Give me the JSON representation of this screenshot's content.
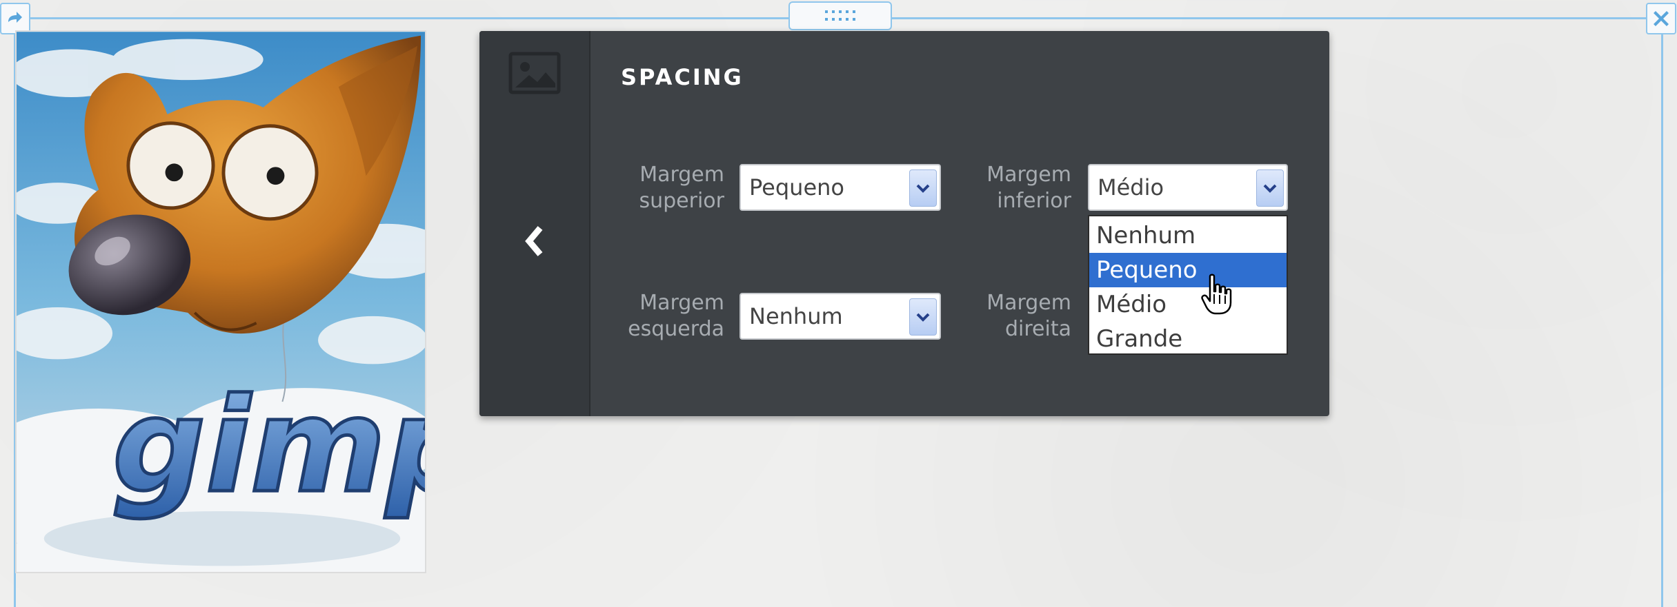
{
  "panel": {
    "title": "SPACING"
  },
  "fields": {
    "top_margin": {
      "label_line1": "Margem",
      "label_line2": "superior",
      "value": "Pequeno"
    },
    "bottom_margin": {
      "label_line1": "Margem",
      "label_line2": "inferior",
      "value": "Médio",
      "expanded": true,
      "options": [
        "Nenhum",
        "Pequeno",
        "Médio",
        "Grande"
      ],
      "highlighted_option": "Pequeno"
    },
    "left_margin": {
      "label_line1": "Margem",
      "label_line2": "esquerda",
      "value": "Nenhum"
    },
    "right_margin": {
      "label_line1": "Margem",
      "label_line2": "direita"
    }
  },
  "image": {
    "logo_text": "gimp"
  },
  "icons": {
    "top_left_handle": "arrow-icon",
    "top_right_handle": "close-icon",
    "top_center_handle": "drag-dots-icon",
    "rail_top": "image-icon",
    "rail_back": "chevron-left-icon",
    "select_arrow": "chevron-down-icon",
    "cursor": "hand-pointer-icon"
  },
  "colors": {
    "frame_border": "#8fc6ec",
    "panel_background": "#3e4246",
    "rail_background": "#35393d",
    "highlight": "#2f6fd0"
  }
}
